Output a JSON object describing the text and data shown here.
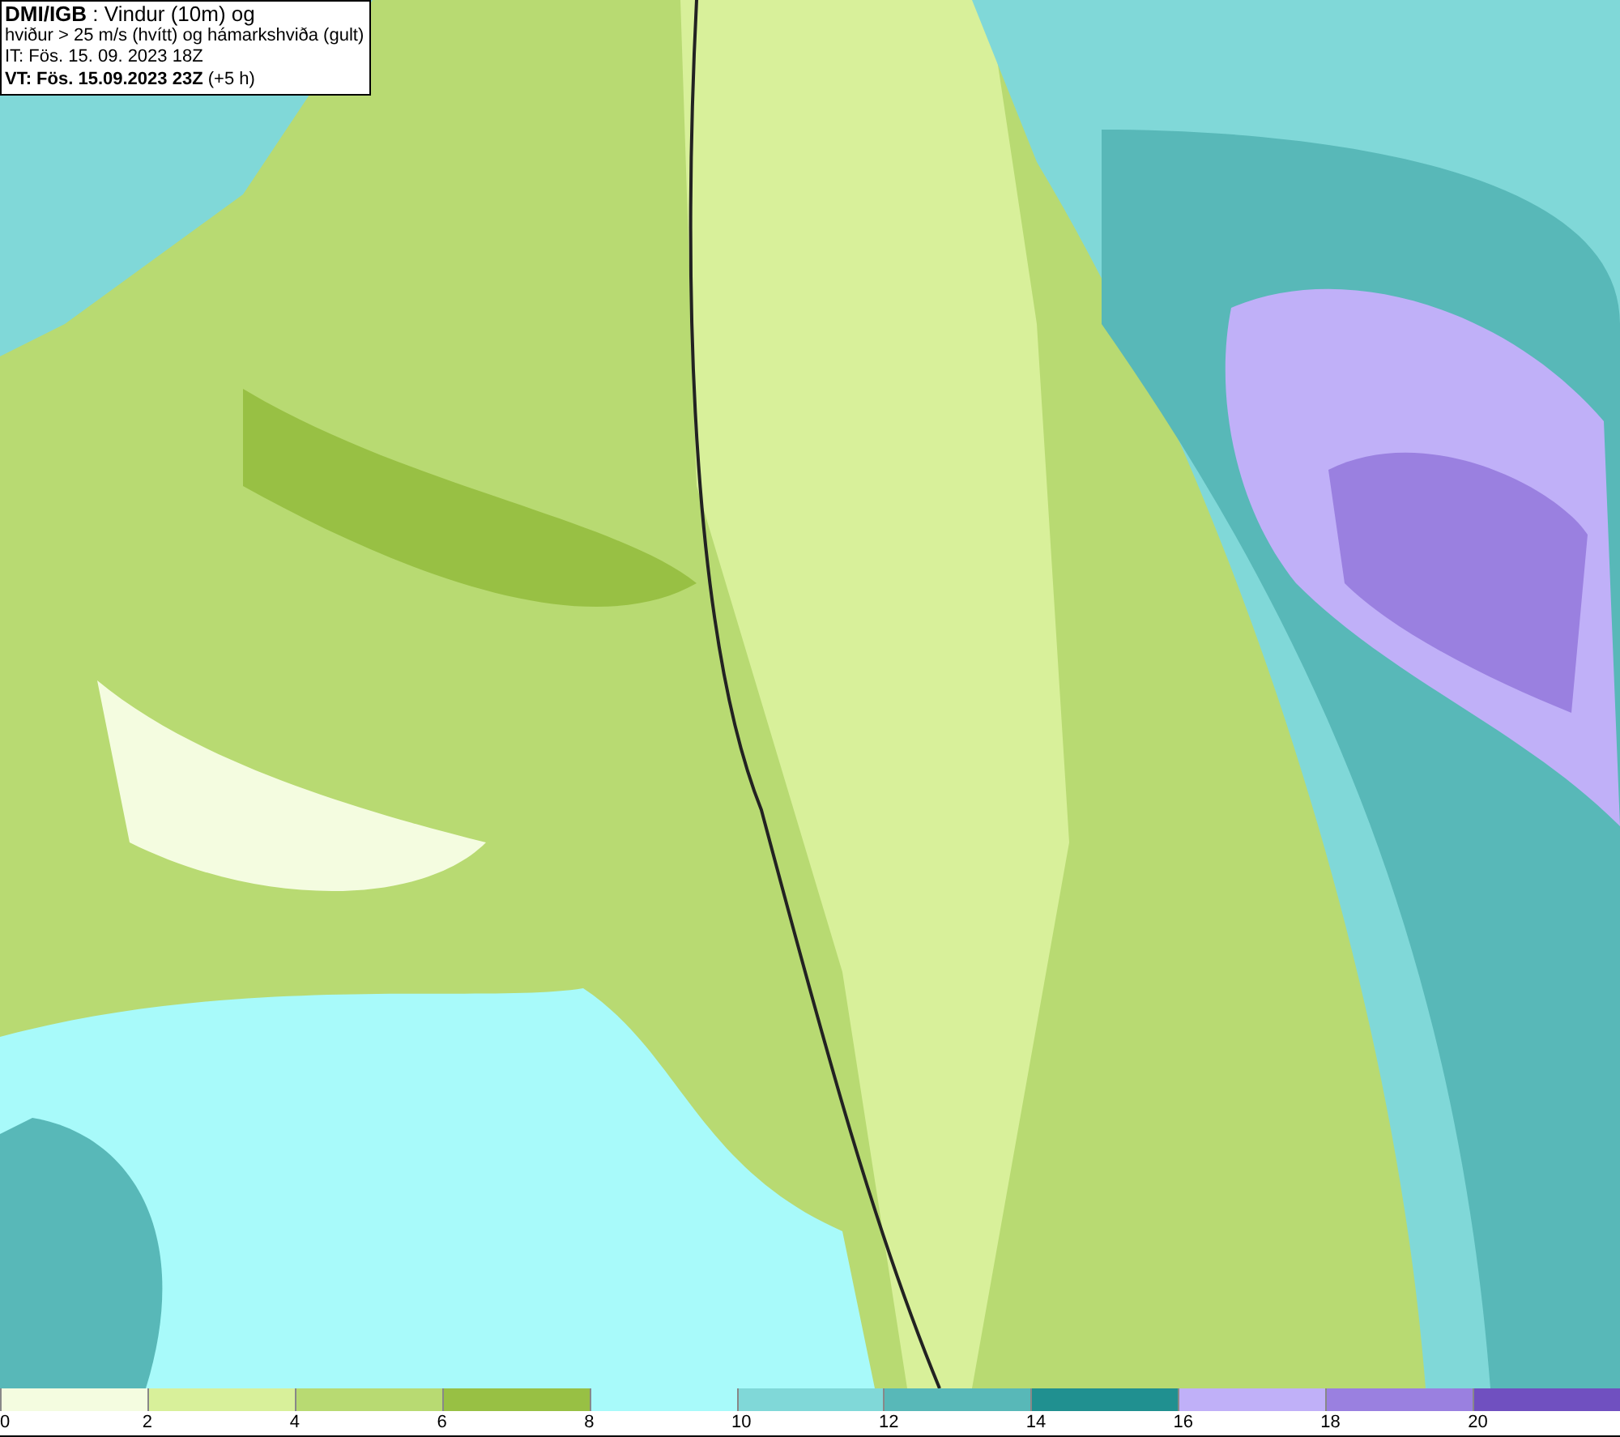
{
  "title_box": {
    "lines": [
      "**DMI/IGB** : Vindur (10m) og",
      "hviður > 25 m/s (hvítt) og hámarkshviða (gult)",
      "IT: Fös. 15. 09. 2023 18Z",
      "**VT: Fös. 15.09.2023 23Z** (+5 h)"
    ]
  },
  "legend": [
    {
      "label": "0",
      "color": "#f4fce0"
    },
    {
      "label": "2",
      "color": "#d8f09a"
    },
    {
      "label": "4",
      "color": "#b8da72"
    },
    {
      "label": "6",
      "color": "#98c044"
    },
    {
      "label": "8",
      "color": "#a8fafa"
    },
    {
      "label": "10",
      "color": "#80d8d8"
    },
    {
      "label": "12",
      "color": "#58b8b8"
    },
    {
      "label": "14",
      "color": "#209090"
    },
    {
      "label": "16",
      "color": "#c0b0f8"
    },
    {
      "label": "18",
      "color": "#9a80e0"
    },
    {
      "label": "20",
      "color": "#7050c0"
    }
  ]
}
